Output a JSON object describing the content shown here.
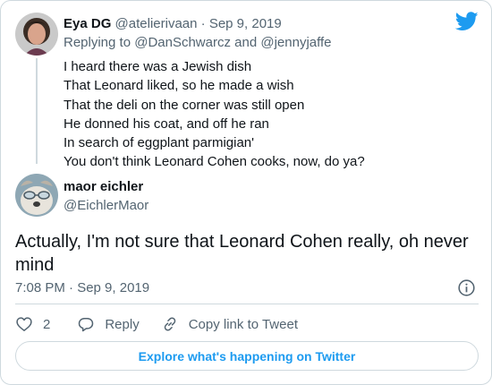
{
  "parent_tweet": {
    "display_name": "Eya DG",
    "handle": "@atelierivaan",
    "separator": " · ",
    "date": "Sep 9, 2019",
    "replying_prefix": "Replying to ",
    "replying_to_1": "@DanSchwarcz",
    "replying_and": " and ",
    "replying_to_2": "@jennyjaffe",
    "lines": [
      "I heard there was a Jewish dish",
      "That Leonard liked, so he made a wish",
      "That the deli on the corner was still open",
      "He donned his coat, and off he ran",
      "In search of eggplant parmigian'",
      "You don't think Leonard Cohen cooks, now, do ya?"
    ]
  },
  "main_tweet": {
    "display_name": "maor eichler",
    "handle": "@EichlerMaor",
    "text": "Actually, I'm not sure that Leonard Cohen really, oh never mind",
    "timestamp": "7:08 PM · Sep 9, 2019"
  },
  "actions": {
    "like_count": "2",
    "reply_label": "Reply",
    "copy_link_label": "Copy link to Tweet"
  },
  "explore_label": "Explore what's happening on Twitter",
  "icons": {
    "logo": "twitter-bird-icon",
    "info": "info-icon",
    "like": "heart-icon",
    "reply": "reply-bubble-icon",
    "copy": "link-icon"
  },
  "colors": {
    "accent": "#1d9bf0",
    "text": "#0f1419",
    "muted": "#536471",
    "border": "#cfd9de"
  }
}
